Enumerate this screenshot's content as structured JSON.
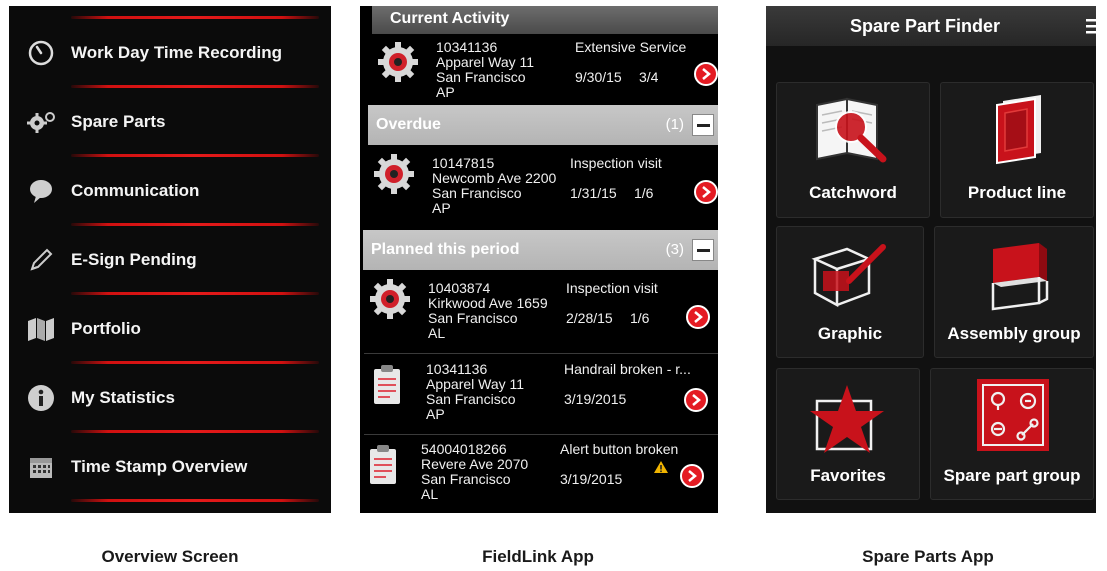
{
  "overview": {
    "items": [
      {
        "label": "Work Day Time Recording",
        "icon": "clock-icon"
      },
      {
        "label": "Spare Parts",
        "icon": "gears-icon"
      },
      {
        "label": "Communication",
        "icon": "speech-bubble-icon"
      },
      {
        "label": "E-Sign Pending",
        "icon": "pencil-icon"
      },
      {
        "label": "Portfolio",
        "icon": "map-icon"
      },
      {
        "label": "My Statistics",
        "icon": "info-icon"
      },
      {
        "label": "Time Stamp Overview",
        "icon": "calendar-icon"
      }
    ],
    "caption": "Overview Screen"
  },
  "fieldlink": {
    "header": "Current Activity",
    "current": {
      "id": "10341136",
      "address": "Apparel Way 11",
      "city": "San Francisco",
      "state": "AP",
      "type": "Extensive Service",
      "date": "9/30/15",
      "progress": "3/4"
    },
    "overdue": {
      "title": "Overdue",
      "count": "(1)"
    },
    "overdue_items": [
      {
        "id": "10147815",
        "address": "Newcomb Ave 2200",
        "city": "San Francisco",
        "state": "AP",
        "type": "Inspection visit",
        "date": "1/31/15",
        "progress": "1/6"
      }
    ],
    "planned": {
      "title": "Planned this period",
      "count": "(3)"
    },
    "planned_items": [
      {
        "id": "10403874",
        "address": "Kirkwood Ave 1659",
        "city": "San Francisco",
        "state": "AL",
        "type": "Inspection visit",
        "date": "2/28/15",
        "progress": "1/6",
        "icon": "gear-icon"
      },
      {
        "id": "10341136",
        "address": "Apparel Way 11",
        "city": "San Francisco",
        "state": "AP",
        "type": "Handrail broken - r...",
        "date": "3/19/2015",
        "progress": "",
        "icon": "clipboard-icon"
      },
      {
        "id": "54004018266",
        "address": "Revere Ave 2070",
        "city": "San Francisco",
        "state": "AL",
        "type": "Alert button broken",
        "date": "3/19/2015",
        "progress": "",
        "icon": "clipboard-icon"
      }
    ],
    "caption": "FieldLink App",
    "colors": {
      "accent": "#e41b23"
    }
  },
  "spareparts": {
    "header": "Spare Part Finder",
    "tiles": [
      {
        "label": "Catchword",
        "icon": "magnifier-book-icon"
      },
      {
        "label": "Product line",
        "icon": "red-book-icon"
      },
      {
        "label": "Graphic",
        "icon": "drawing-icon"
      },
      {
        "label": "Assembly group",
        "icon": "cube-icon"
      },
      {
        "label": "Favorites",
        "icon": "star-icon"
      },
      {
        "label": "Spare part group",
        "icon": "parts-grid-icon"
      }
    ],
    "caption": "Spare Parts App"
  }
}
